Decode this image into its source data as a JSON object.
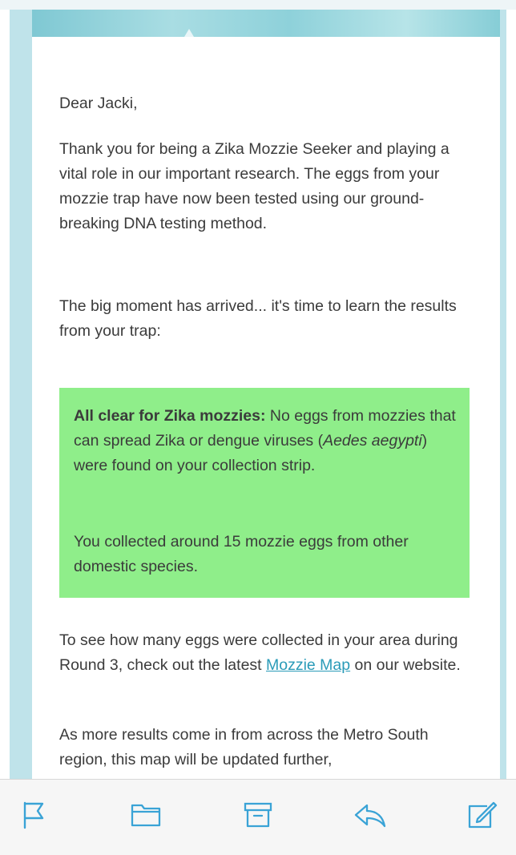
{
  "email": {
    "greeting": "Dear Jacki,",
    "paragraph1": "Thank you for being a Zika Mozzie Seeker and playing a vital role in our important research. The eggs from your mozzie trap have now been tested using our ground-breaking DNA testing method.",
    "paragraph2": "The big moment has arrived... it's time to learn the results from your trap:",
    "result": {
      "heading": "All clear for Zika mozzies:",
      "text_before_species": " No eggs from mozzies that can spread Zika or dengue viruses (",
      "species": "Aedes aegypti",
      "text_after_species": ") were found on your collection strip.",
      "count_text": "You collected around 15 mozzie eggs from other domestic species."
    },
    "paragraph3_before": "To see how many eggs were collected in your area during Round 3, check out the latest ",
    "paragraph3_link": "Mozzie Map",
    "paragraph3_after": " on our website.",
    "paragraph4": "As more results come in from across the Metro South region, this map will be updated further,"
  },
  "toolbar": {
    "icons": [
      "flag-icon",
      "folder-icon",
      "archive-icon",
      "reply-icon",
      "compose-icon"
    ],
    "icon_color": "#3aa3d6"
  },
  "colors": {
    "result_box": "#8fee8a",
    "frame": "#bfe3ea",
    "link": "#2a9bb8"
  }
}
